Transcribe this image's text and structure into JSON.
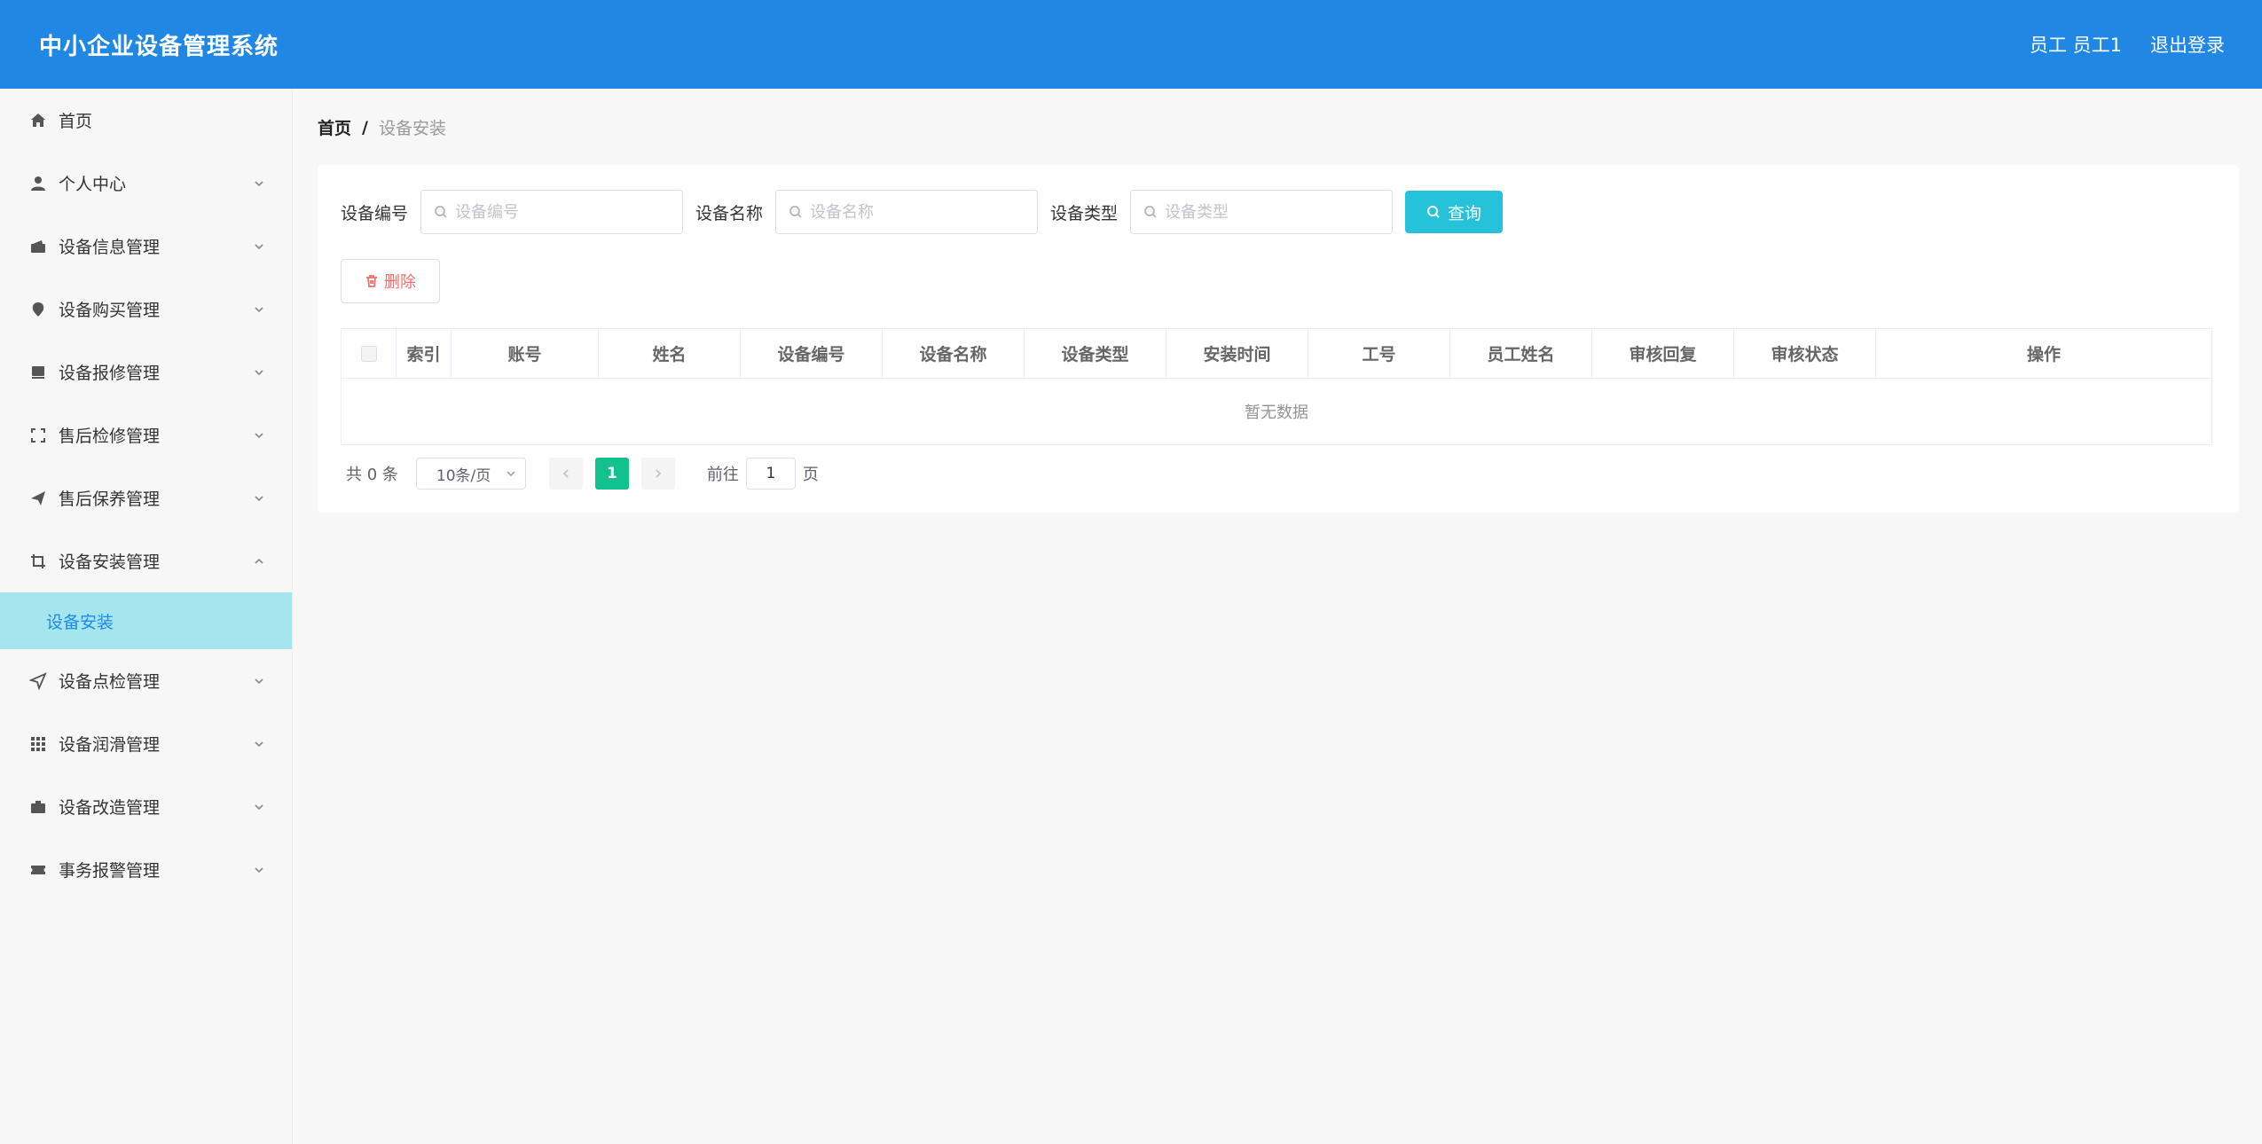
{
  "header": {
    "title": "中小企业设备管理系统",
    "user": "员工 员工1",
    "logout": "退出登录"
  },
  "sidebar": {
    "items": [
      {
        "label": "首页",
        "icon": "home-icon",
        "has_chevron": false
      },
      {
        "label": "个人中心",
        "icon": "user-icon",
        "has_chevron": true
      },
      {
        "label": "设备信息管理",
        "icon": "wallet-icon",
        "has_chevron": true
      },
      {
        "label": "设备购买管理",
        "icon": "location-pin-icon",
        "has_chevron": true
      },
      {
        "label": "设备报修管理",
        "icon": "notebook-icon",
        "has_chevron": true
      },
      {
        "label": "售后检修管理",
        "icon": "full-screen-icon",
        "has_chevron": true
      },
      {
        "label": "售后保养管理",
        "icon": "send-icon",
        "has_chevron": true
      },
      {
        "label": "设备安装管理",
        "icon": "crop-icon",
        "has_chevron": true,
        "expanded": true
      },
      {
        "label": "设备点检管理",
        "icon": "navigation-icon",
        "has_chevron": true
      },
      {
        "label": "设备润滑管理",
        "icon": "grid-icon",
        "has_chevron": true
      },
      {
        "label": "设备改造管理",
        "icon": "briefcase-icon",
        "has_chevron": true
      },
      {
        "label": "事务报警管理",
        "icon": "ticket-icon",
        "has_chevron": true
      }
    ],
    "active_sub": "设备安装"
  },
  "breadcrumb": {
    "home": "首页",
    "separator": "/",
    "current": "设备安装"
  },
  "search": {
    "field1_label": "设备编号",
    "field1_placeholder": "设备编号",
    "field2_label": "设备名称",
    "field2_placeholder": "设备名称",
    "field3_label": "设备类型",
    "field3_placeholder": "设备类型",
    "query_button": "查询"
  },
  "actions": {
    "delete_button": "删除"
  },
  "table": {
    "columns": [
      "索引",
      "账号",
      "姓名",
      "设备编号",
      "设备名称",
      "设备类型",
      "安装时间",
      "工号",
      "员工姓名",
      "审核回复",
      "审核状态",
      "操作"
    ],
    "empty_text": "暂无数据"
  },
  "pagination": {
    "total": "共 0 条",
    "page_size": "10条/页",
    "current_page": "1",
    "goto_label": "前往",
    "goto_value": "1",
    "page_suffix": "页"
  },
  "colors": {
    "header_bg": "#2088e4",
    "active_sub_bg": "#a5e6ee",
    "query_button": "#25c2da",
    "current_page": "#11c28e",
    "delete_text": "#f56c6c"
  }
}
